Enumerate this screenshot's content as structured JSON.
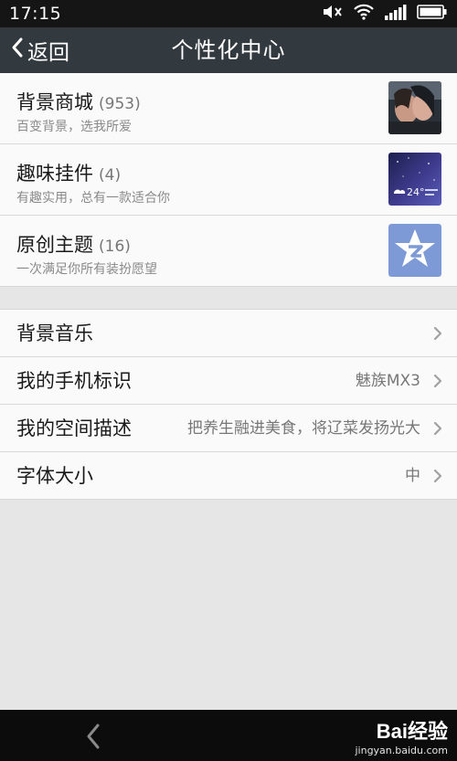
{
  "status": {
    "time": "17:15"
  },
  "header": {
    "back_label": "返回",
    "title": "个性化中心"
  },
  "features": [
    {
      "name": "背景商城",
      "count": "(953)",
      "desc": "百变背景，选我所爱",
      "thumb_icon": "background-thumb-icon"
    },
    {
      "name": "趣味挂件",
      "count": "(4)",
      "desc": "有趣实用，总有一款适合你",
      "thumb_icon": "widget-thumb-icon",
      "thumb_text": "24°"
    },
    {
      "name": "原创主题",
      "count": "(16)",
      "desc": "一次满足你所有装扮愿望",
      "thumb_icon": "theme-thumb-icon"
    }
  ],
  "settings": [
    {
      "label": "背景音乐",
      "value": ""
    },
    {
      "label": "我的手机标识",
      "value": "魅族MX3"
    },
    {
      "label": "我的空间描述",
      "value": "把养生融进美食，将辽菜发扬光大"
    },
    {
      "label": "字体大小",
      "value": "中"
    }
  ],
  "watermark": {
    "brand": "Bai经验",
    "site": "jingyan.baidu.com"
  },
  "colors": {
    "titlebar": "#333a3f",
    "statusbar": "#151515",
    "page_bg": "#e6e6e6",
    "card_bg": "#fafafa"
  }
}
